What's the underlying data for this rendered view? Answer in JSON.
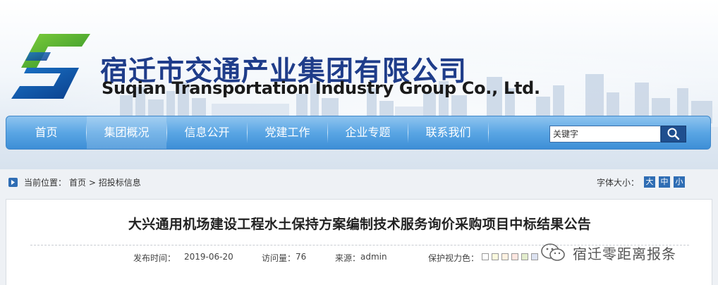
{
  "header": {
    "brand_cn": "宿迁市交通产业集团有限公司",
    "brand_en": "Suqian Transportation Industry Group Co., Ltd."
  },
  "nav": {
    "items": [
      {
        "label": "首页"
      },
      {
        "label": "集团概况"
      },
      {
        "label": "信息公开"
      },
      {
        "label": "党建工作"
      },
      {
        "label": "企业专题"
      },
      {
        "label": "联系我们"
      }
    ],
    "active_index": 1,
    "search_placeholder": "关键字",
    "search_icon": "search-icon"
  },
  "breadcrumb": {
    "label": "当前位置：",
    "home": "首页",
    "sep": ">",
    "current": "招投标信息"
  },
  "font_size": {
    "label": "字体大小：",
    "large": "大",
    "medium": "中",
    "small": "小"
  },
  "article": {
    "title": "大兴通用机场建设工程水土保持方案编制技术服务询价采购项目中标结果公告",
    "publish_label": "发布时间：",
    "publish_date": "2019-06-20",
    "views_label": "访问量：",
    "views": "76",
    "source_label": "来源：",
    "source": "admin",
    "eye_color_label": "保护视力色："
  },
  "watermark": {
    "text": "宿迁零距离报条"
  },
  "colors": {
    "nav_gradient_top": "#8fc4ef",
    "nav_gradient_bottom": "#3d8ed6",
    "brand_blue": "#1f3d8a",
    "font_btn": "#2f6db4",
    "search_btn": "#1f4f8f"
  }
}
